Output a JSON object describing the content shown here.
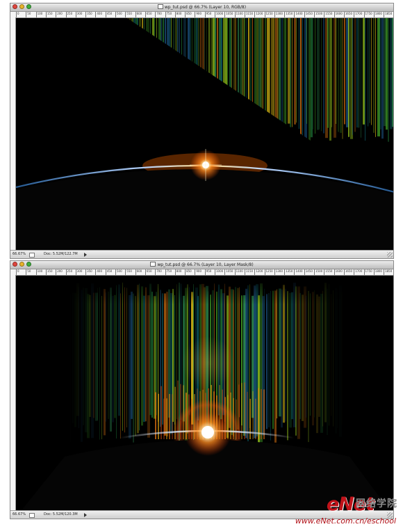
{
  "window1": {
    "title": "wp_tut.psd @ 66.7% (Layer 10, RGB/8)",
    "zoom": "66.67%",
    "doc": "Doc: 5.52M/122.7M"
  },
  "window2": {
    "title": "wp_tut.psd @ 66.7% (Layer 10, Layer Mask/8)",
    "zoom": "66.67%",
    "doc": "Doc: 5.52M/120.3M"
  },
  "ruler_ticks": [
    "0",
    "50",
    "100",
    "150",
    "200",
    "250",
    "300",
    "350",
    "400",
    "450",
    "500",
    "550",
    "600",
    "650",
    "700",
    "750",
    "800",
    "850",
    "900",
    "950",
    "1000",
    "1050",
    "1100",
    "1150",
    "1200",
    "1250",
    "1300",
    "1350",
    "1400",
    "1450",
    "1500",
    "1550",
    "1600",
    "1650",
    "1700",
    "1750",
    "1800",
    "1850"
  ],
  "watermark": {
    "logo": "eNet",
    "chinese": "网络学院",
    "url": "www.eNet.com.cn/eschool"
  },
  "colors": {
    "background": "#000000",
    "glow": "#ff8a1e",
    "watermark_red": "#c0131a"
  }
}
